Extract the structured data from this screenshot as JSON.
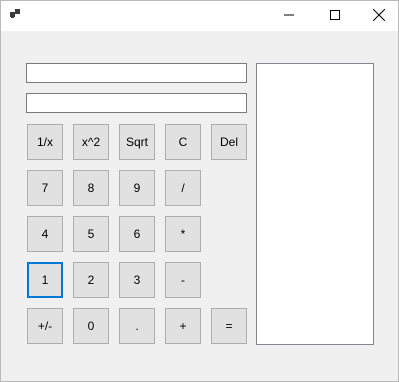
{
  "titlebar": {
    "app_icon": "window-app-icon",
    "minimize_icon": "minimize-icon",
    "maximize_icon": "maximize-icon",
    "close_icon": "close-icon"
  },
  "display": {
    "expression_value": "",
    "result_value": ""
  },
  "history": {
    "items": []
  },
  "keypad": {
    "reciprocal": "1/x",
    "square": "x^2",
    "sqrt": "Sqrt",
    "clear": "C",
    "delete": "Del",
    "seven": "7",
    "eight": "8",
    "nine": "9",
    "divide": "/",
    "four": "4",
    "five": "5",
    "six": "6",
    "multiply": "*",
    "one": "1",
    "two": "2",
    "three": "3",
    "subtract": "-",
    "negate": "+/-",
    "zero": "0",
    "decimal": ".",
    "add": "+",
    "equals": "="
  },
  "colors": {
    "focus_accent": "#0078d7",
    "button_face": "#e1e1e1",
    "window_bg": "#f0f0f0"
  }
}
